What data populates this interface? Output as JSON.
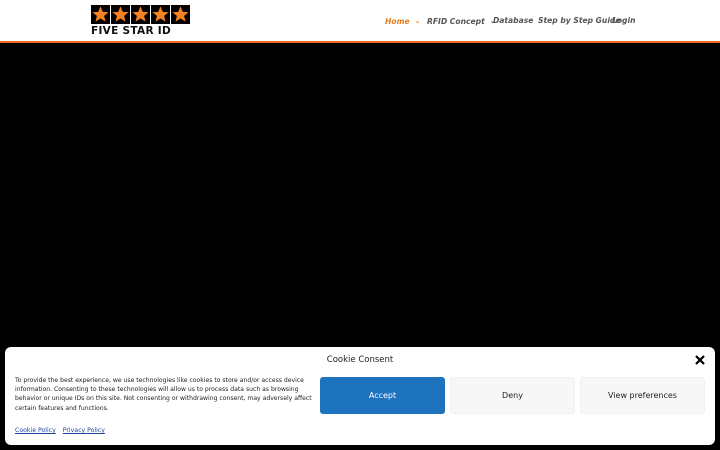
{
  "brand": {
    "name": "FIVE STAR ID",
    "star_color": "#f58220",
    "accent": "#e67e22"
  },
  "nav": {
    "items": [
      {
        "label": "Home",
        "has_dropdown": true,
        "active": true
      },
      {
        "label": "RFID Concept",
        "has_dropdown": true,
        "active": false
      },
      {
        "label": "Database",
        "has_dropdown": false,
        "active": false
      },
      {
        "label": "Step by Step Guide",
        "has_dropdown": false,
        "active": false
      },
      {
        "label": "Login",
        "has_dropdown": false,
        "active": false
      }
    ]
  },
  "cookie": {
    "title": "Cookie Consent",
    "body": "To provide the best experience, we use technologies like cookies to store and/or access device information. Consenting to these technologies will allow us to process data such as browsing behavior or unique IDs on this site. Not consenting or withdrawing consent, may adversely affect certain features and functions.",
    "accept_label": "Accept",
    "deny_label": "Deny",
    "prefs_label": "View preferences",
    "cookie_policy_label": "Cookie Policy",
    "privacy_policy_label": "Privacy Policy",
    "accept_color": "#1e73be"
  }
}
